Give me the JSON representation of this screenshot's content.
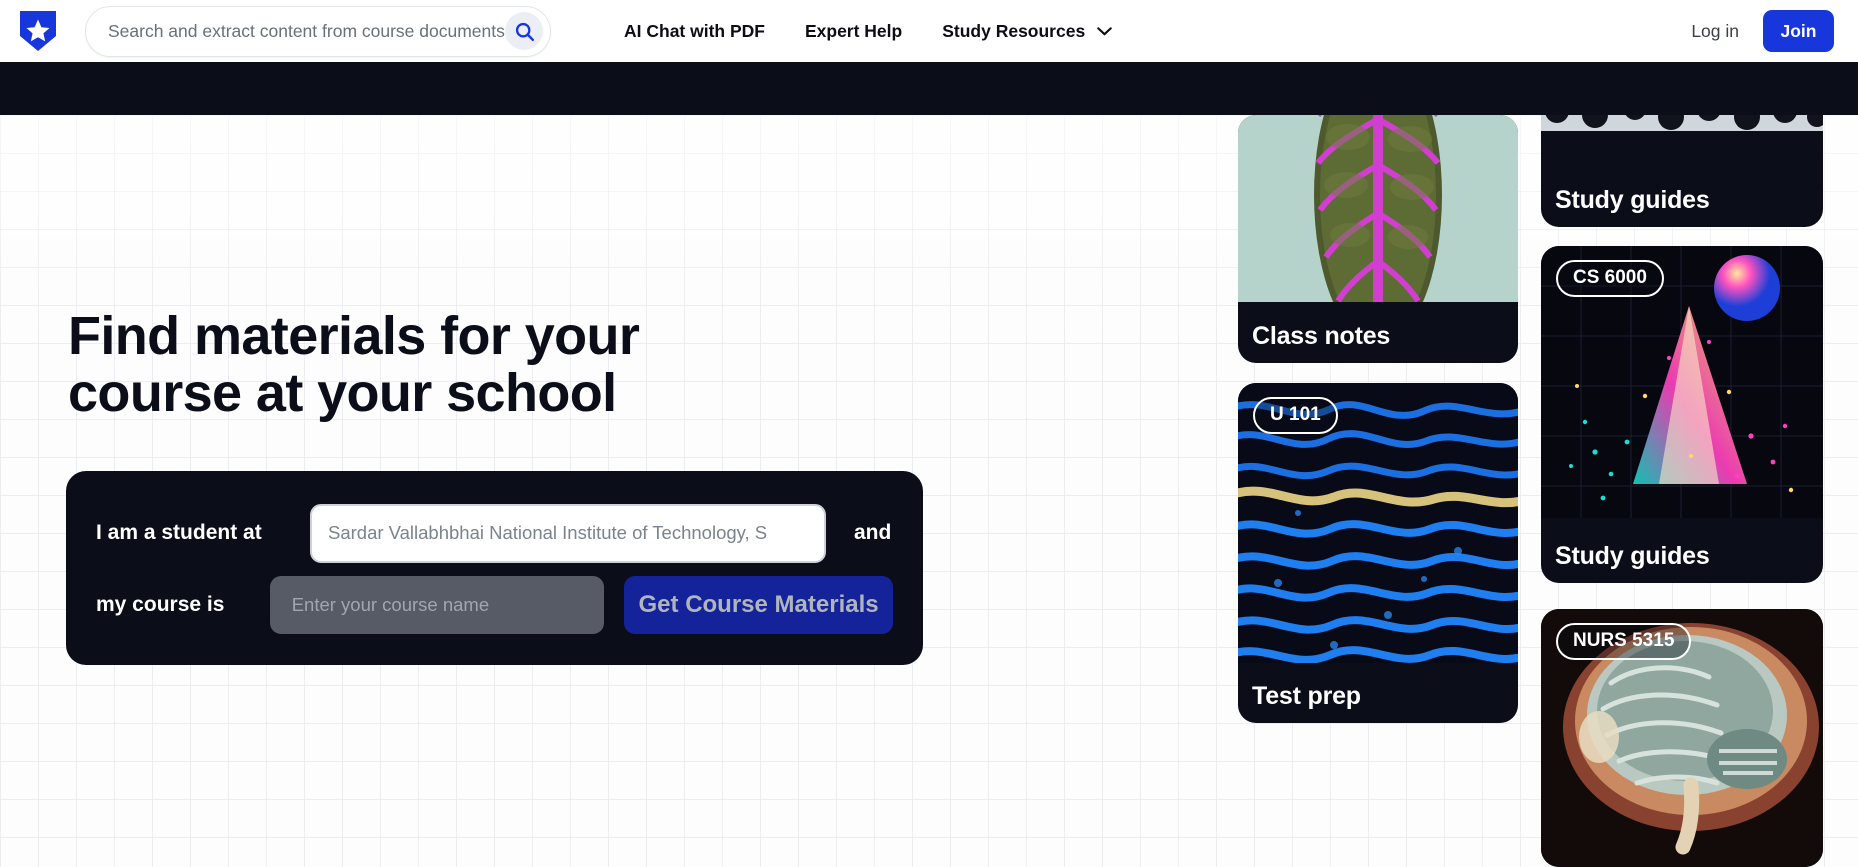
{
  "nav": {
    "logo_icon": "shield-star-logo",
    "search": {
      "placeholder": "Search and extract content from course documents,",
      "value": "",
      "icon": "search-icon"
    },
    "links": [
      {
        "label": "AI Chat with PDF",
        "has_caret": false
      },
      {
        "label": "Expert Help",
        "has_caret": false
      },
      {
        "label": "Study Resources",
        "has_caret": true,
        "caret_icon": "chevron-down-icon"
      }
    ],
    "login_label": "Log in",
    "join_label": "Join",
    "join_color": "#1736dc"
  },
  "hero": {
    "headline": "Find materials for your course at your school",
    "form": {
      "school_label": "I am a student at",
      "school_placeholder": "Sardar Vallabhbhai National Institute of Technology, S",
      "school_value": "",
      "and_label": "and",
      "course_label": "my course is",
      "course_placeholder": "Enter your course name",
      "course_value": "",
      "submit_label": "Get Course Materials",
      "submit_color": "#14239a",
      "card_color": "#0b0d18"
    }
  },
  "collage": {
    "cards": [
      {
        "id": "class-notes",
        "title": "Class notes",
        "badge": "",
        "art": "leaf-macro"
      },
      {
        "id": "test-prep",
        "title": "Test prep",
        "badge": "U 101",
        "art": "brain-coral"
      },
      {
        "id": "study-top",
        "title": "Study guides",
        "badge": "",
        "art": "cell-micrograph"
      },
      {
        "id": "study-mid",
        "title": "Study guides",
        "badge": "CS 6000",
        "art": "point-cloud-sphere"
      },
      {
        "id": "nurs",
        "title": "",
        "badge": "NURS 5315",
        "art": "brain-mri-sagittal"
      }
    ]
  }
}
